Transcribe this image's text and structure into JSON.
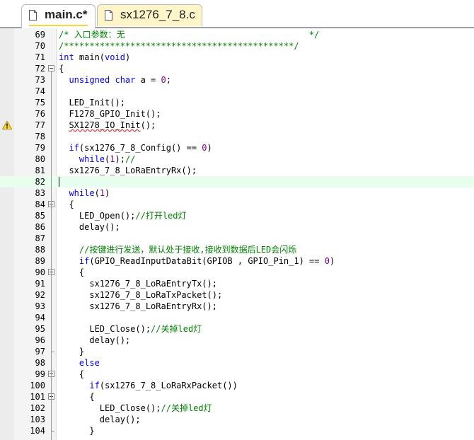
{
  "tabs": [
    {
      "label": "main.c*",
      "active": true
    },
    {
      "label": "sx1276_7_8.c",
      "active": false
    }
  ],
  "colors": {
    "keyword": "#0000ff",
    "comment": "#008000",
    "number": "#7f007f",
    "current_line": "#e8fff0",
    "inactive_tab": "#fff5c8"
  },
  "gutter_icons": {
    "line_77": "warning-icon"
  },
  "lines": [
    {
      "n": "69",
      "segs": [
        [
          "cm",
          "/* 入口参数：无                                    */"
        ]
      ]
    },
    {
      "n": "70",
      "segs": [
        [
          "cm",
          "/*********************************************/"
        ]
      ]
    },
    {
      "n": "71",
      "segs": [
        [
          "kw",
          "int"
        ],
        [
          "",
          " main("
        ],
        [
          "kw",
          "void"
        ],
        [
          "",
          ")"
        ]
      ]
    },
    {
      "n": "72",
      "segs": [
        [
          "",
          "{"
        ]
      ]
    },
    {
      "n": "73",
      "segs": [
        [
          "",
          "  "
        ],
        [
          "kw",
          "unsigned char"
        ],
        [
          "",
          " a = "
        ],
        [
          "nm",
          "0"
        ],
        [
          "",
          ";"
        ]
      ]
    },
    {
      "n": "74",
      "segs": []
    },
    {
      "n": "75",
      "segs": [
        [
          "",
          "  LED_Init();"
        ]
      ]
    },
    {
      "n": "76",
      "segs": [
        [
          "",
          "  F1278_GPIO_Init();"
        ]
      ]
    },
    {
      "n": "77",
      "segs": [
        [
          "",
          "  "
        ],
        [
          "sq",
          "SX1278_IO_Init"
        ],
        [
          "",
          "();"
        ]
      ]
    },
    {
      "n": "78",
      "segs": []
    },
    {
      "n": "79",
      "segs": [
        [
          "",
          "  "
        ],
        [
          "kw",
          "if"
        ],
        [
          "",
          "(sx1276_7_8_Config() == "
        ],
        [
          "nm",
          "0"
        ],
        [
          "",
          ")"
        ]
      ]
    },
    {
      "n": "80",
      "segs": [
        [
          "",
          "    "
        ],
        [
          "kw",
          "while"
        ],
        [
          "",
          "("
        ],
        [
          "nm",
          "1"
        ],
        [
          "",
          ");"
        ],
        [
          "cm",
          "//"
        ]
      ]
    },
    {
      "n": "81",
      "segs": [
        [
          "",
          "  sx1276_7_8_LoRaEntryRx();"
        ]
      ]
    },
    {
      "n": "82",
      "segs": []
    },
    {
      "n": "83",
      "segs": [
        [
          "",
          "  "
        ],
        [
          "kw",
          "while"
        ],
        [
          "",
          "("
        ],
        [
          "nm",
          "1"
        ],
        [
          "",
          ")"
        ]
      ]
    },
    {
      "n": "84",
      "segs": [
        [
          "",
          "  {"
        ]
      ]
    },
    {
      "n": "85",
      "segs": [
        [
          "",
          "    LED_Open();"
        ],
        [
          "cm",
          "//打开led灯"
        ]
      ]
    },
    {
      "n": "86",
      "segs": [
        [
          "",
          "    delay();"
        ]
      ]
    },
    {
      "n": "87",
      "segs": []
    },
    {
      "n": "88",
      "segs": [
        [
          "",
          "    "
        ],
        [
          "cm",
          "//按键进行发送，默认处于接收,接收到数据后LED会闪烁"
        ]
      ]
    },
    {
      "n": "89",
      "segs": [
        [
          "",
          "    "
        ],
        [
          "kw",
          "if"
        ],
        [
          "",
          "(GPIO_ReadInputDataBit(GPIOB , GPIO_Pin_1) == "
        ],
        [
          "nm",
          "0"
        ],
        [
          "",
          ")"
        ]
      ]
    },
    {
      "n": "90",
      "segs": [
        [
          "",
          "    {"
        ]
      ]
    },
    {
      "n": "91",
      "segs": [
        [
          "",
          "      sx1276_7_8_LoRaEntryTx();"
        ]
      ]
    },
    {
      "n": "92",
      "segs": [
        [
          "",
          "      sx1276_7_8_LoRaTxPacket();"
        ]
      ]
    },
    {
      "n": "93",
      "segs": [
        [
          "",
          "      sx1276_7_8_LoRaEntryRx();"
        ]
      ]
    },
    {
      "n": "94",
      "segs": []
    },
    {
      "n": "95",
      "segs": [
        [
          "",
          "      LED_Close();"
        ],
        [
          "cm",
          "//关掉led灯"
        ]
      ]
    },
    {
      "n": "96",
      "segs": [
        [
          "",
          "      delay();"
        ]
      ]
    },
    {
      "n": "97",
      "segs": [
        [
          "",
          "    }"
        ]
      ]
    },
    {
      "n": "98",
      "segs": [
        [
          "",
          "    "
        ],
        [
          "kw",
          "else"
        ]
      ]
    },
    {
      "n": "99",
      "segs": [
        [
          "",
          "    {"
        ]
      ]
    },
    {
      "n": "100",
      "segs": [
        [
          "",
          "      "
        ],
        [
          "kw",
          "if"
        ],
        [
          "",
          "(sx1276_7_8_LoRaRxPacket())"
        ]
      ]
    },
    {
      "n": "101",
      "segs": [
        [
          "",
          "      {"
        ]
      ]
    },
    {
      "n": "102",
      "segs": [
        [
          "",
          "        LED_Close();"
        ],
        [
          "cm",
          "//关掉led灯"
        ]
      ]
    },
    {
      "n": "103",
      "segs": [
        [
          "",
          "        delay();"
        ]
      ]
    },
    {
      "n": "104",
      "segs": [
        [
          "",
          "      }"
        ]
      ]
    }
  ]
}
